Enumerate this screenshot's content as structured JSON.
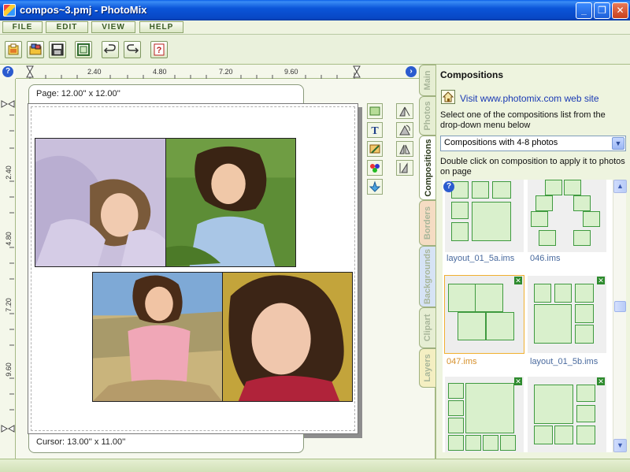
{
  "window": {
    "title": "compos~3.pmj - PhotoMix",
    "minimize_glyph": "_",
    "maximize_glyph": "❐",
    "close_glyph": "✕"
  },
  "menu": [
    "FILE",
    "EDIT",
    "VIEW",
    "HELP"
  ],
  "toolbar": {
    "buttons": [
      "new-project-icon",
      "open-photos-icon",
      "save-icon",
      "frame-icon",
      "undo-icon",
      "redo-icon",
      "help-book-icon"
    ]
  },
  "ruler": {
    "top_labels": [
      "2.40",
      "4.80",
      "7.20",
      "9.60"
    ],
    "left_labels": [
      "2.40",
      "4.80",
      "7.20",
      "9.60"
    ],
    "help_glyph": "?"
  },
  "canvas": {
    "page_size": "Page: 12.00'' x 12.00''",
    "cursor": "Cursor: 13.00'' x 11.00''",
    "photos": [
      "girl-lying-on-pillow",
      "girl-lying-in-grass",
      "girl-in-field",
      "curly-haired-girl-closeup"
    ]
  },
  "tabs": [
    "Main",
    "Photos",
    "Compositions",
    "Borders",
    "Backgrounds",
    "Clipart",
    "Layers"
  ],
  "active_tab": "Compositions",
  "panel": {
    "title": "Compositions",
    "website_link": "Visit www.photomix.com web site",
    "select_instruction": "Select one of the compositions list from the drop-down menu below",
    "dropdown_value": "Compositions with 4-8 photos",
    "apply_instruction": "Double click on composition to apply it to photos on page",
    "help_glyph": "?",
    "layouts": [
      {
        "name": "layout_01_5a.ims",
        "selected": false
      },
      {
        "name": "046.ims",
        "selected": false
      },
      {
        "name": "047.ims",
        "selected": true
      },
      {
        "name": "layout_01_5b.ims",
        "selected": false
      },
      {
        "name": "",
        "selected": false
      },
      {
        "name": "",
        "selected": false
      }
    ],
    "remove_glyph": "✕",
    "scroll_up": "▲",
    "scroll_down": "▼",
    "dropdown_arrow": "▼"
  },
  "colors": {
    "titlebar": "#0b55d9",
    "panel_bg": "#eef4df",
    "layout_cell_fill": "#d9f0cc",
    "layout_cell_border": "#3f9a3f",
    "selected_outline": "#f0b030",
    "link": "#1a3ab4"
  }
}
